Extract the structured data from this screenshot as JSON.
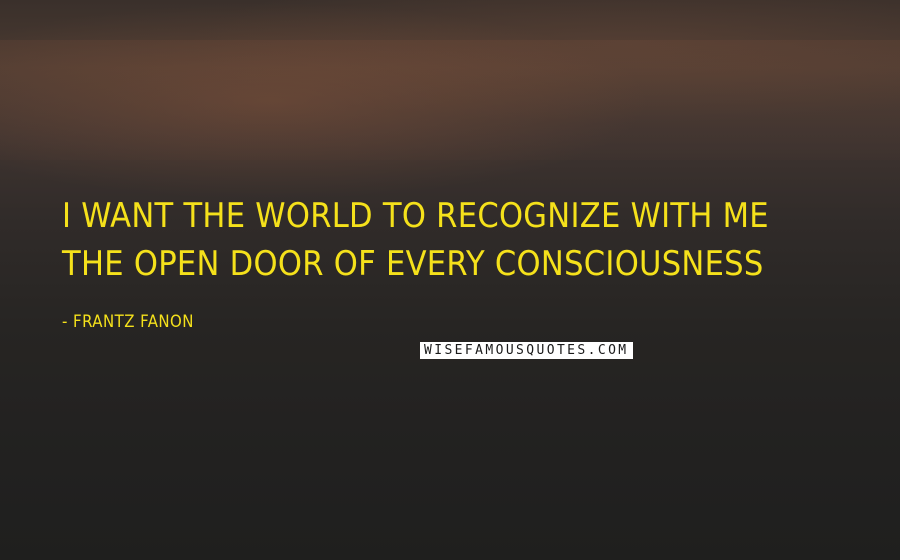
{
  "quote": {
    "lines": [
      "I WANT THE WORLD TO RECOGNIZE WITH ME",
      "THE OPEN DOOR OF EVERY CONSCIOUSNESS"
    ],
    "author": "- FRANTZ FANON"
  },
  "watermark": "WISEFAMOUSQUOTES.COM",
  "colors": {
    "text": "#f5e11b",
    "background": "#2b2725"
  }
}
